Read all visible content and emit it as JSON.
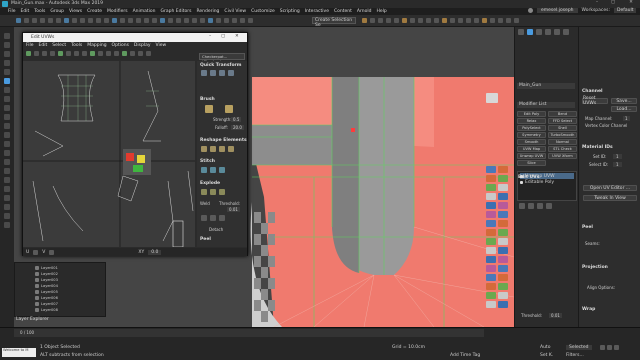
{
  "app": {
    "title": "Main_Gun.max - Autodesk 3ds Max 2019"
  },
  "menubar": [
    "File",
    "Edit",
    "Tools",
    "Group",
    "Views",
    "Create",
    "Modifiers",
    "Animation",
    "Graph Editors",
    "Rendering",
    "Civil View",
    "Customize",
    "Scripting",
    "Interactive",
    "Content",
    "Arnold",
    "Help"
  ],
  "top_right": {
    "user": "emesel.joseph",
    "workspaces_label": "Workspaces:",
    "workspace_value": "Default"
  },
  "toolbar": {
    "selection_set": "Create Selection Se"
  },
  "uv_editor": {
    "title": "Edit UVWs",
    "menu": [
      "File",
      "Edit",
      "Select",
      "Tools",
      "Mapping",
      "Options",
      "Display",
      "View"
    ],
    "sub_toolbar": [
      "Move Points",
      "Align",
      "Copy",
      "Paste",
      "Shift Overlap"
    ],
    "texture_dropdown": "Checkerpat... (Checker )",
    "panels": {
      "quick_transform": "Quick Transform",
      "brush": "Brush",
      "strength_label": "Strength:",
      "strength_value": "0.5",
      "falloff_label": "Falloff:",
      "falloff_value": "20.0",
      "reshape": "Reshape Elements",
      "stitch": "Stitch",
      "explode": "Explode",
      "weld": "Weld",
      "threshold_label": "Threshold:",
      "threshold_value": "0.01",
      "detach": "Detach",
      "peel": "Peel"
    },
    "bottom": {
      "u_label": "U",
      "v_label": "V",
      "xy_label": "XY",
      "xy_value": "0.0"
    }
  },
  "viewport": {
    "label": "Layer Explorer",
    "sub_labels": [
      "Scene Explorer",
      "Layer Explorer"
    ]
  },
  "layer_list": [
    "Layer001",
    "Layer002",
    "Layer003",
    "Layer004",
    "Layer005",
    "Layer006",
    "Layer007",
    "Layer008"
  ],
  "command_panel": {
    "object_name": "Main_Gun",
    "modifier_list": "Modifier List",
    "buttons": [
      [
        "Edit Poly",
        "Bend"
      ],
      [
        "Relax",
        "FFD Select"
      ],
      [
        "PolySelect",
        "Shell"
      ],
      [
        "Symmetry",
        "TurboSmooth"
      ],
      [
        "Smooth",
        "Normal"
      ],
      [
        "UVW Map",
        "STL Check"
      ],
      [
        "Unwrap UVW",
        "UVW Xform"
      ],
      [
        "Slice",
        ""
      ]
    ],
    "stack": [
      "Unwrap UVW",
      "Editable Poly"
    ],
    "edit_uvs": "Edit UVs",
    "open_uv_editor": "Open UV Editor ...",
    "tweak_in_view": "Tweak In View",
    "peel_title": "Peel",
    "seams_label": "Seams:",
    "projection_title": "Projection",
    "align_options": "Align Options:",
    "wrap_title": "Wrap",
    "threshold_label": "Threshold:",
    "threshold_value": "0.01"
  },
  "right_panel": {
    "channel_title": "Channel",
    "reset_uvws": "Reset UVWs",
    "save": "Save...",
    "load": "Load...",
    "map_channel": "Map Channel:",
    "map_channel_value": "1",
    "vertex_color_channel": "Vertex Color Channel",
    "material_ids": "Material IDs",
    "set_id_label": "Set ID:",
    "set_id_value": "1",
    "select_id_label": "Select ID:",
    "select_id_value": "1"
  },
  "status": {
    "selected": "1 Object Selected",
    "hint": "ALT subtracts from selection",
    "grid": "Grid = 10.0cm",
    "add_time_tag": "Add Time Tag",
    "auto": "Auto",
    "selected_dd": "Selected",
    "set_key": "Set K.",
    "filters": "Filters...",
    "frame": "0 / 100",
    "maxscript": "Welcome to M"
  },
  "colors": {
    "accent_blue": "#4a9be0",
    "viewport_red": "#f07a6e",
    "uv_green": "#5fd35f",
    "panel_bg": "#2b2b2b"
  }
}
